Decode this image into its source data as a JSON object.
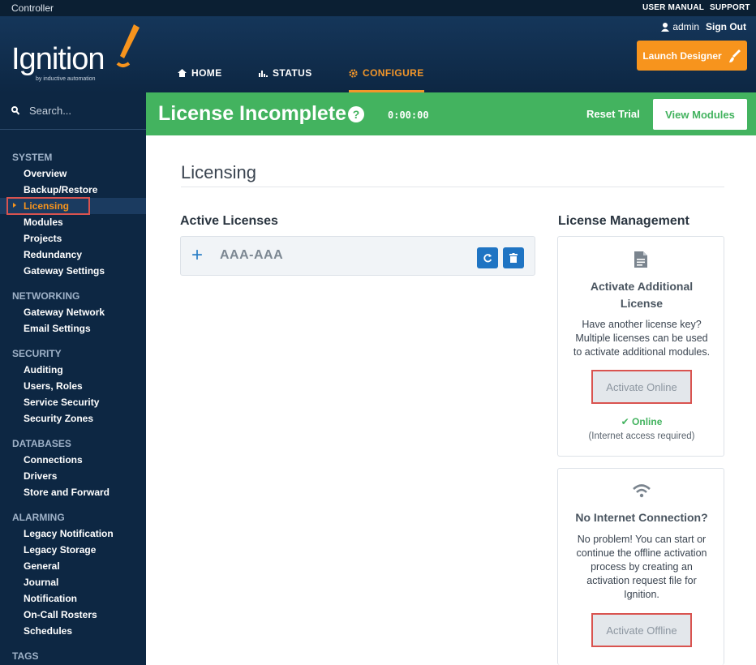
{
  "topbar": {
    "controller": "Controller",
    "user_manual": "USER MANUAL",
    "support": "SUPPORT"
  },
  "header": {
    "logo_word": "Ignition",
    "logo_tagline": "by inductive automation",
    "user": "admin",
    "sign_out": "Sign Out",
    "launch_designer": "Launch Designer",
    "nav": [
      {
        "label": "HOME",
        "icon": "home-icon"
      },
      {
        "label": "STATUS",
        "icon": "bar-chart-icon"
      },
      {
        "label": "CONFIGURE",
        "icon": "gear-icon"
      }
    ],
    "colors": {
      "accent": "#f7941d",
      "header": "#15365a"
    }
  },
  "sidebar": {
    "search_placeholder": "Search...",
    "sections": [
      {
        "title": "SYSTEM",
        "items": [
          "Overview",
          "Backup/Restore",
          "Licensing",
          "Modules",
          "Projects",
          "Redundancy",
          "Gateway Settings"
        ]
      },
      {
        "title": "NETWORKING",
        "items": [
          "Gateway Network",
          "Email Settings"
        ]
      },
      {
        "title": "SECURITY",
        "items": [
          "Auditing",
          "Users, Roles",
          "Service Security",
          "Security Zones"
        ]
      },
      {
        "title": "DATABASES",
        "items": [
          "Connections",
          "Drivers",
          "Store and Forward"
        ]
      },
      {
        "title": "ALARMING",
        "items": [
          "Legacy Notification",
          "Legacy Storage",
          "General",
          "Journal",
          "Notification",
          "On-Call Rosters",
          "Schedules"
        ]
      },
      {
        "title": "TAGS",
        "items": []
      }
    ],
    "active_item": "Licensing"
  },
  "banner": {
    "title": "License Incomplete",
    "help": "?",
    "timer": "0:00:00",
    "reset_trial": "Reset Trial",
    "view_modules": "View Modules",
    "color": "#43b35f"
  },
  "main": {
    "page_title": "Licensing",
    "active_licenses": {
      "heading": "Active Licenses",
      "plus": "+",
      "key": "AAA-AAA"
    },
    "management": {
      "heading": "License Management",
      "card1": {
        "title_line1": "Activate Additional",
        "title_line2": "License",
        "body_line1": "Have another license key?",
        "body_line2": "Multiple licenses can be used",
        "body_line3": "to activate additional modules.",
        "button": "Activate Online",
        "status": "Online",
        "note": "(Internet access required)"
      },
      "card2": {
        "title": "No Internet Connection?",
        "body_line1": "No problem! You can start or",
        "body_line2": "continue the offline activation",
        "body_line3": "process by creating an",
        "body_line4": "activation request file for",
        "body_line5": "Ignition.",
        "button": "Activate Offline"
      }
    }
  }
}
